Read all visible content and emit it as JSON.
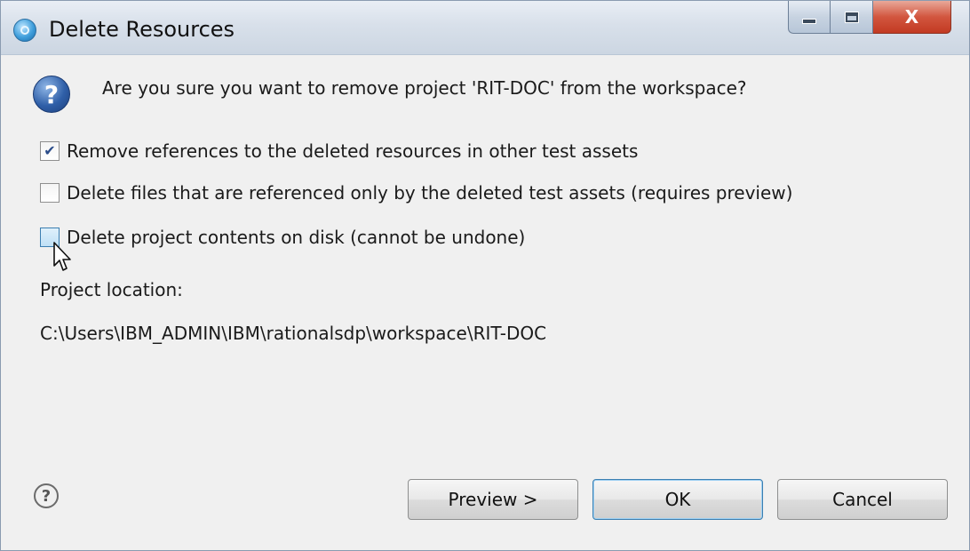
{
  "window": {
    "title": "Delete Resources",
    "close_symbol": "X"
  },
  "message": {
    "icon": "question-icon",
    "text": "Are you sure you want to remove project 'RIT-DOC' from the workspace?"
  },
  "options": [
    {
      "label": "Remove references to the deleted resources in other test assets",
      "checked": true
    },
    {
      "label": "Delete files that are referenced only by the deleted test assets (requires preview)",
      "checked": false
    },
    {
      "label": "Delete project contents on disk (cannot be undone)",
      "checked": false
    }
  ],
  "location": {
    "label": "Project location:",
    "path": "C:\\Users\\IBM_ADMIN\\IBM\\rationalsdp\\workspace\\RIT-DOC"
  },
  "footer": {
    "help_symbol": "?",
    "preview_label": "Preview >",
    "ok_label": "OK",
    "cancel_label": "Cancel"
  },
  "colors": {
    "accent": "#3c7fb1",
    "close_button": "#c23a22"
  }
}
